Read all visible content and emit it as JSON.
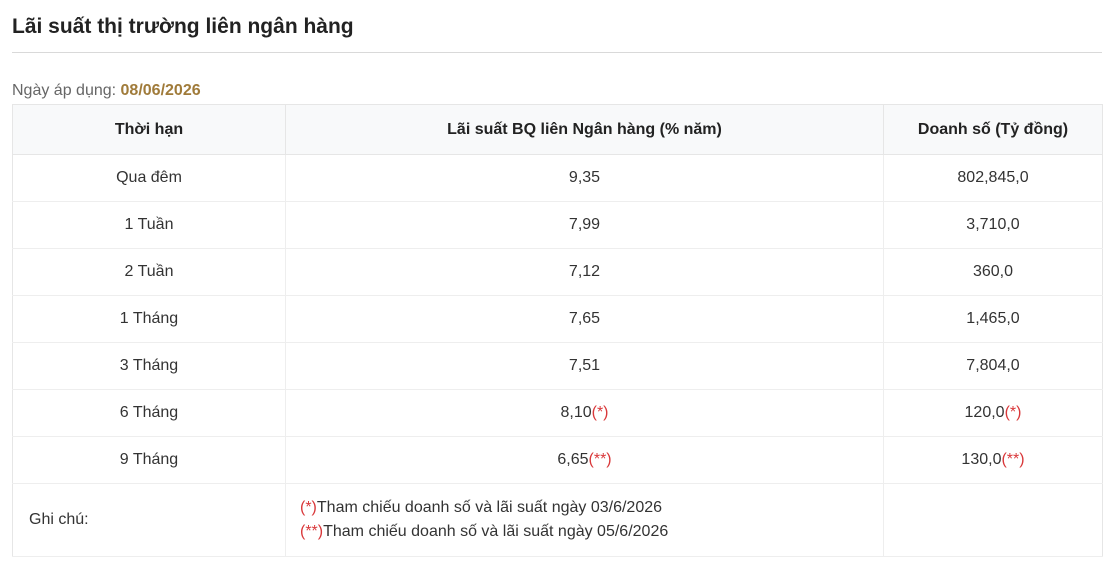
{
  "title": "Lãi suất thị trường liên ngân hàng",
  "date": {
    "label": "Ngày áp dụng:",
    "value": "08/06/2026"
  },
  "table": {
    "headers": [
      "Thời hạn",
      "Lãi suất BQ liên Ngân hàng (% năm)",
      "Doanh số (Tỷ đồng)"
    ],
    "rows": [
      {
        "term": "Qua đêm",
        "rate": "9,35",
        "rate_mark": "",
        "volume": "802,845,0",
        "volume_mark": ""
      },
      {
        "term": "1 Tuần",
        "rate": "7,99",
        "rate_mark": "",
        "volume": "3,710,0",
        "volume_mark": ""
      },
      {
        "term": "2 Tuần",
        "rate": "7,12",
        "rate_mark": "",
        "volume": "360,0",
        "volume_mark": ""
      },
      {
        "term": "1 Tháng",
        "rate": "7,65",
        "rate_mark": "",
        "volume": "1,465,0",
        "volume_mark": ""
      },
      {
        "term": "3 Tháng",
        "rate": "7,51",
        "rate_mark": "",
        "volume": "7,804,0",
        "volume_mark": ""
      },
      {
        "term": "6 Tháng",
        "rate": "8,10",
        "rate_mark": "(*)",
        "volume": "120,0",
        "volume_mark": "(*)"
      },
      {
        "term": "9 Tháng",
        "rate": "6,65",
        "rate_mark": "(**)",
        "volume": "130,0",
        "volume_mark": "(**)"
      }
    ],
    "notes": {
      "label": "Ghi chú:",
      "items": [
        {
          "mark": "(*)",
          "text": "Tham chiếu doanh số và lãi suất ngày 03/6/2026"
        },
        {
          "mark": "(**)",
          "text": "Tham chiếu doanh số và lãi suất ngày 05/6/2026"
        }
      ]
    }
  },
  "colors": {
    "date_value": "#a07b3a",
    "mark": "#d9383a",
    "header_bg": "#f8f9fa"
  }
}
